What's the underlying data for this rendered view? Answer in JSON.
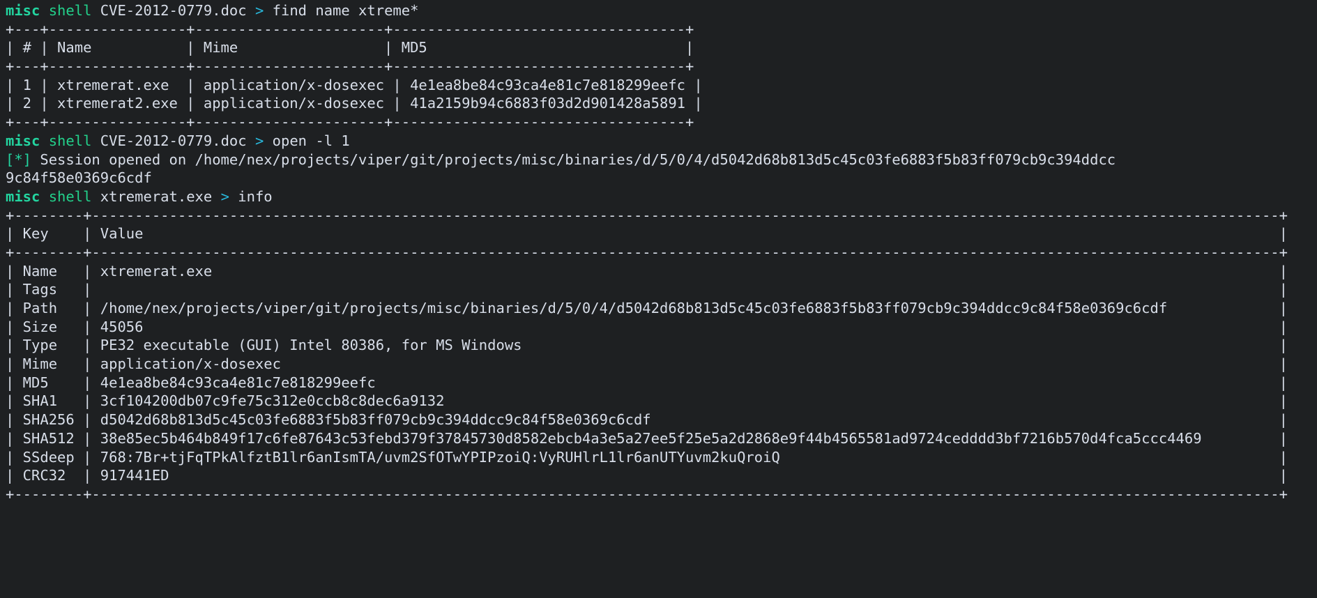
{
  "terminal": {
    "app": "viper-shell",
    "colors": {
      "background": "#1e2022",
      "foreground": "#d8dee9",
      "prompt_module": "#23d5a0",
      "prompt_shell": "#23d18b",
      "prompt_arrow": "#29b8db",
      "status_mark": "#23d5a0"
    },
    "prompts": {
      "module": "misc",
      "shell": "shell",
      "arrow": ">"
    },
    "blocks": [
      {
        "kind": "prompt",
        "module": "misc",
        "shell": "shell",
        "target": "CVE-2012-0779.doc",
        "arrow": ">",
        "command": "find name xtreme*"
      },
      {
        "kind": "table",
        "border_top": "+---+----------------+----------------------+----------------------------------+",
        "header": "| # | Name           | Mime                 | MD5                              |",
        "border_mid": "+---+----------------+----------------------+----------------------------------+",
        "rows": [
          "| 1 | xtremerat.exe  | application/x-dosexec | 4e1ea8be84c93ca4e81c7e818299eefc |",
          "| 2 | xtremerat2.exe | application/x-dosexec | 41a2159b94c6883f03d2d901428a5891 |"
        ],
        "border_bottom": "+---+----------------+----------------------+----------------------------------+"
      },
      {
        "kind": "prompt",
        "module": "misc",
        "shell": "shell",
        "target": "CVE-2012-0779.doc",
        "arrow": ">",
        "command": "open -l 1"
      },
      {
        "kind": "status",
        "mark": "[*]",
        "text": " Session opened on /home/nex/projects/viper/git/projects/misc/binaries/d/5/0/4/d5042d68b813d5c45c03fe6883f5b83ff079cb9c394ddcc9c84f58e0369c6cdf"
      },
      {
        "kind": "prompt",
        "module": "misc",
        "shell": "shell",
        "target": "xtremerat.exe",
        "arrow": ">",
        "command": "info"
      },
      {
        "kind": "info_table",
        "border": "+--------+------------------------------------------------------------------------------------------------------------------------------------------+",
        "header_key": "Key",
        "header_value": "Value",
        "key_width": 8,
        "value_width": 138,
        "rows": [
          {
            "key": "Name",
            "value": "xtremerat.exe"
          },
          {
            "key": "Tags",
            "value": ""
          },
          {
            "key": "Path",
            "value": "/home/nex/projects/viper/git/projects/misc/binaries/d/5/0/4/d5042d68b813d5c45c03fe6883f5b83ff079cb9c394ddcc9c84f58e0369c6cdf"
          },
          {
            "key": "Size",
            "value": "45056"
          },
          {
            "key": "Type",
            "value": "PE32 executable (GUI) Intel 80386, for MS Windows"
          },
          {
            "key": "Mime",
            "value": "application/x-dosexec"
          },
          {
            "key": "MD5",
            "value": "4e1ea8be84c93ca4e81c7e818299eefc"
          },
          {
            "key": "SHA1",
            "value": "3cf104200db07c9fe75c312e0ccb8c8dec6a9132"
          },
          {
            "key": "SHA256",
            "value": "d5042d68b813d5c45c03fe6883f5b83ff079cb9c394ddcc9c84f58e0369c6cdf"
          },
          {
            "key": "SHA512",
            "value": "38e85ec5b464b849f17c6fe87643c53febd379f37845730d8582ebcb4a3e5a27ee5f25e5a2d2868e9f44b4565581ad9724cedddd3bf7216b570d4fca5ccc4469"
          },
          {
            "key": "SSdeep",
            "value": "768:7Br+tjFqTPkAlfztB1lr6anIsmTA/uvm2SfOTwYPIPzoiQ:VyRUHlrL1lr6anUTYuvm2kuQroiQ"
          },
          {
            "key": "CRC32",
            "value": "917441ED"
          }
        ]
      }
    ]
  }
}
